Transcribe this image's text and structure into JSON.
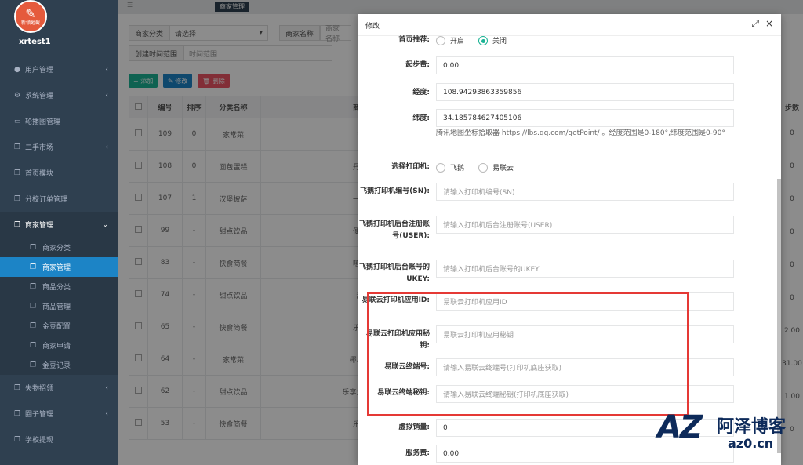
{
  "sidebar": {
    "logo_text": "新领地截",
    "username": "xrtest1",
    "items": [
      {
        "label": "用户管理"
      },
      {
        "label": "系统管理"
      },
      {
        "label": "轮播图管理"
      },
      {
        "label": "二手市场"
      },
      {
        "label": "首页模块"
      },
      {
        "label": "分校订单管理"
      },
      {
        "label": "商家管理"
      },
      {
        "label": "失物招领"
      },
      {
        "label": "圈子管理"
      },
      {
        "label": "学校提现"
      }
    ],
    "sub_items": [
      {
        "label": "商家分类"
      },
      {
        "label": "商家管理"
      },
      {
        "label": "商品分类"
      },
      {
        "label": "商品管理"
      },
      {
        "label": "金豆配置"
      },
      {
        "label": "商家申请"
      },
      {
        "label": "金豆记录"
      }
    ]
  },
  "topbar": {
    "active_tab": "商家管理"
  },
  "filter": {
    "category_label": "商家分类",
    "category_value": "请选择",
    "name_label": "商家名称",
    "name_placeholder": "商家名称",
    "time_label": "创建时间范围",
    "time_placeholder": "时间范围"
  },
  "toolbar": {
    "add": "添加",
    "edit": "修改",
    "delete": "删除"
  },
  "table": {
    "headers": [
      "编号",
      "排序",
      "分类名称",
      "商家名称"
    ],
    "rows": [
      [
        "109",
        "0",
        "家常菜",
        "羊羊肉"
      ],
      [
        "108",
        "0",
        "面包蛋糕",
        "丹芮小店"
      ],
      [
        "107",
        "1",
        "汉堡披萨",
        "一个小店"
      ],
      [
        "99",
        "-",
        "甜点饮品",
        "便利小店"
      ],
      [
        "83",
        "-",
        "快食简餐",
        "嘻哈小店"
      ],
      [
        "74",
        "-",
        "甜点饮品",
        "甜一点"
      ],
      [
        "65",
        "-",
        "快食简餐",
        "乐乐快餐"
      ],
      [
        "64",
        "-",
        "家常菜",
        "椰岛鱼火锅"
      ],
      [
        "62",
        "-",
        "甜点饮品",
        "乐享生日网红店"
      ],
      [
        "53",
        "-",
        "快食简餐",
        "乐乐快餐"
      ]
    ]
  },
  "right_column": {
    "header": "步数",
    "values": [
      "0",
      "0",
      "0",
      "0",
      "0",
      "0",
      "2.00",
      "31.00",
      "1.00",
      "0"
    ]
  },
  "dialog": {
    "title": "修改",
    "home_recommend_label": "首页推荐:",
    "home_recommend_options": [
      "开启",
      "关闭"
    ],
    "home_recommend_selected": "关闭",
    "start_fee_label": "起步费:",
    "start_fee_value": "0.00",
    "longitude_label": "经度:",
    "longitude_value": "108.94293863359856",
    "latitude_label": "纬度:",
    "latitude_value": "34.185784627405106",
    "coord_hint": "腾讯地图坐标拾取器 https://lbs.qq.com/getPoint/ 。经度范围是0-180°,纬度范围是0-90°",
    "printer_label": "选择打印机:",
    "printer_options": [
      "飞鹅",
      "易联云"
    ],
    "feie_sn_label": "飞鹅打印机编号(SN):",
    "feie_sn_placeholder": "请输入打印机编号(SN)",
    "feie_user_label": "飞鹅打印机后台注册账号(USER):",
    "feie_user_placeholder": "请输入打印机后台注册账号(USER)",
    "feie_ukey_label": "飞鹅打印机后台账号的UKEY:",
    "feie_ukey_placeholder": "请输入打印机后台账号的UKEY",
    "ylyun_appid_label": "易联云打印机应用ID:",
    "ylyun_appid_placeholder": "易联云打印机应用ID",
    "ylyun_secret_label": "易联云打印机应用秘钥:",
    "ylyun_secret_placeholder": "易联云打印机应用秘钥",
    "ylyun_terminal_label": "易联云终端号:",
    "ylyun_terminal_placeholder": "请输入易联云终端号(打印机底座获取)",
    "ylyun_terminal_secret_label": "易联云终端秘钥:",
    "ylyun_terminal_secret_placeholder": "请输入易联云终端秘钥(打印机底座获取)",
    "virtual_sales_label": "虚拟销量:",
    "virtual_sales_value": "0",
    "service_fee_label": "服务费:",
    "service_fee_value": "0.00"
  },
  "watermark": {
    "brand": "阿泽博客",
    "url": "az0.cn"
  }
}
